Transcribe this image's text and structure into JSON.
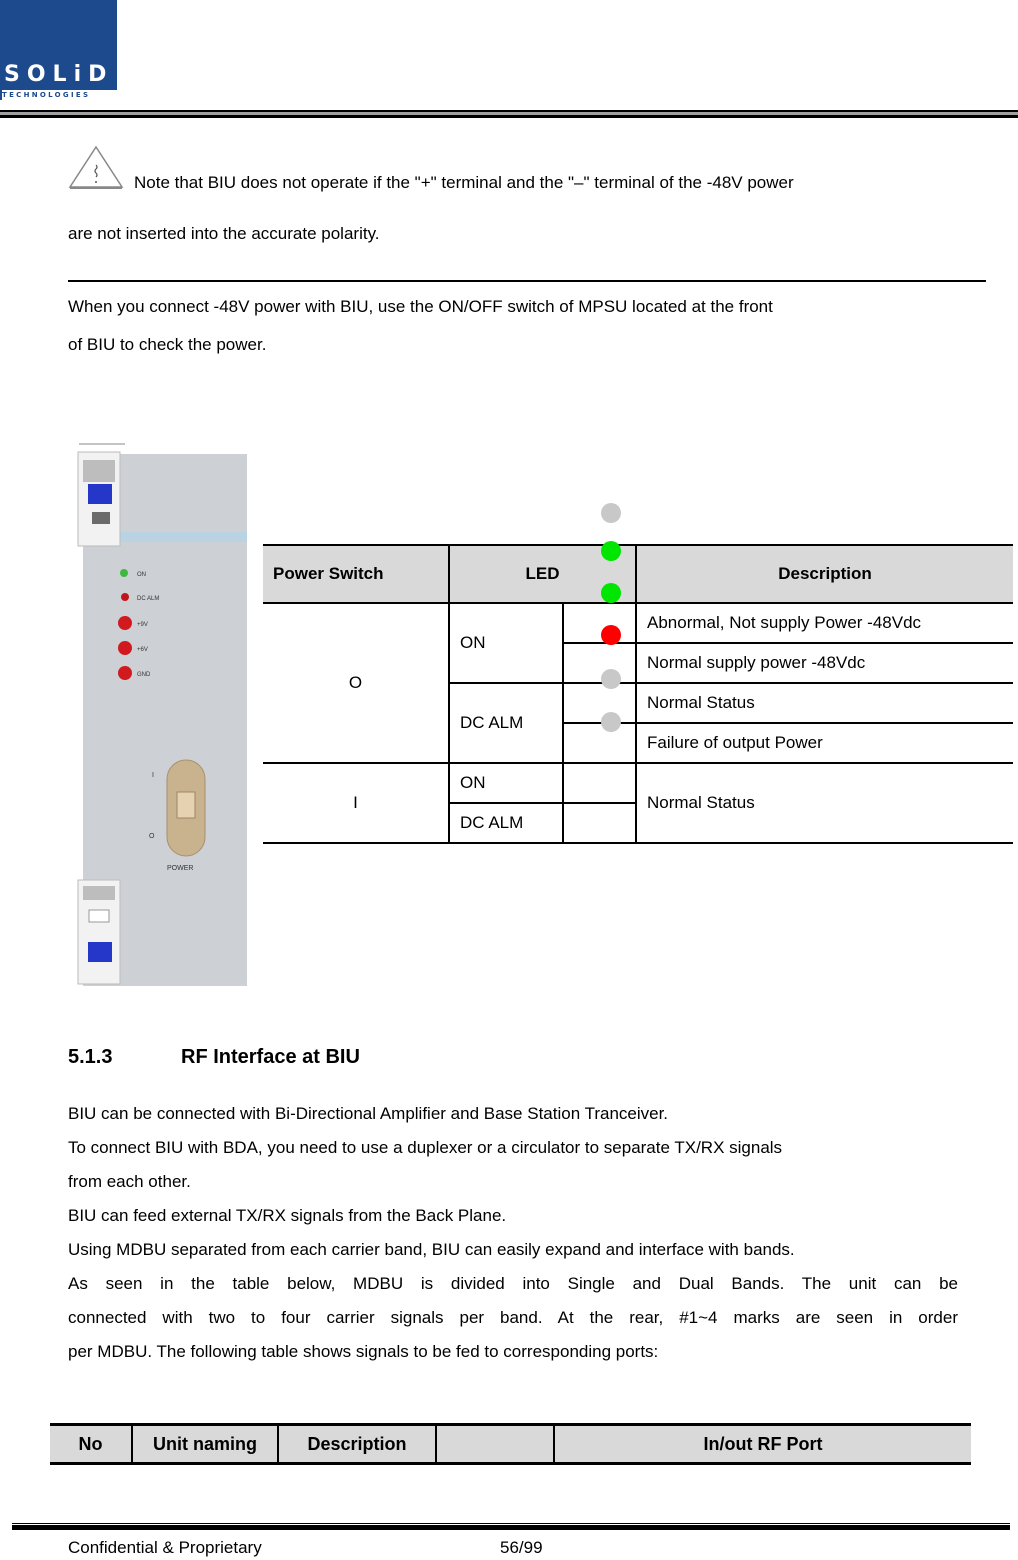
{
  "header": {
    "logo": {
      "main": "SOLiD",
      "sub": "TECHNOLOGIES",
      "color": "#1c4a8c"
    }
  },
  "note": {
    "icon": "warning-triangle-icon",
    "line1": "Note that BIU does not operate if the \"+\" terminal and the \"–\" terminal of the -48V power",
    "line2": "are not inserted into the accurate polarity."
  },
  "intro": {
    "line1": "When you connect -48V power with BIU, use the ON/OFF switch of MPSU located at the front",
    "line2": "of BIU to check the power."
  },
  "device_photo": {
    "leds": [
      "ON",
      "DC ALM",
      "+9V",
      "+6V",
      "GND"
    ],
    "switch_labels": [
      "I",
      "O"
    ],
    "switch_caption": "POWER"
  },
  "led_table": {
    "headers": [
      "Power Switch",
      "LED",
      "Description"
    ],
    "rows": [
      {
        "switch": "O",
        "led": "ON",
        "descriptions": [
          "Abnormal, Not supply Power -48Vdc",
          "Normal supply power -48Vdc"
        ]
      },
      {
        "switch": "O",
        "led": "DC ALM",
        "descriptions": [
          "Normal Status",
          "Failure of output Power"
        ]
      },
      {
        "switch": "I",
        "leds": [
          "ON",
          "DC ALM"
        ],
        "description": "Normal Status"
      }
    ],
    "indicator_colors": [
      "#c8c8c8",
      "#00e600",
      "#00e600",
      "#ff0000",
      "#c8c8c8",
      "#c8c8c8"
    ]
  },
  "section": {
    "number": "5.1.3",
    "title": "RF Interface at BIU",
    "paragraphs": [
      "BIU can be connected with Bi-Directional Amplifier and Base Station Tranceiver.",
      "To connect BIU with BDA, you need to use a duplexer or a circulator to separate TX/RX signals",
      "from each other.",
      "BIU can feed external TX/RX signals from the Back Plane.",
      "Using MDBU separated from each carrier band, BIU can easily expand and interface with bands.",
      "As seen in the table below, MDBU is divided into Single and Dual Bands. The unit can be",
      "connected with two to four carrier signals per band. At the rear, #1~4 marks are seen in order",
      "per MDBU. The following table shows signals to be fed to corresponding ports:"
    ]
  },
  "rf_table": {
    "headers": [
      "No",
      "Unit naming",
      "Description",
      "",
      "In/out RF Port"
    ]
  },
  "footer": {
    "left": "Confidential & Proprietary",
    "page": "56/99"
  }
}
